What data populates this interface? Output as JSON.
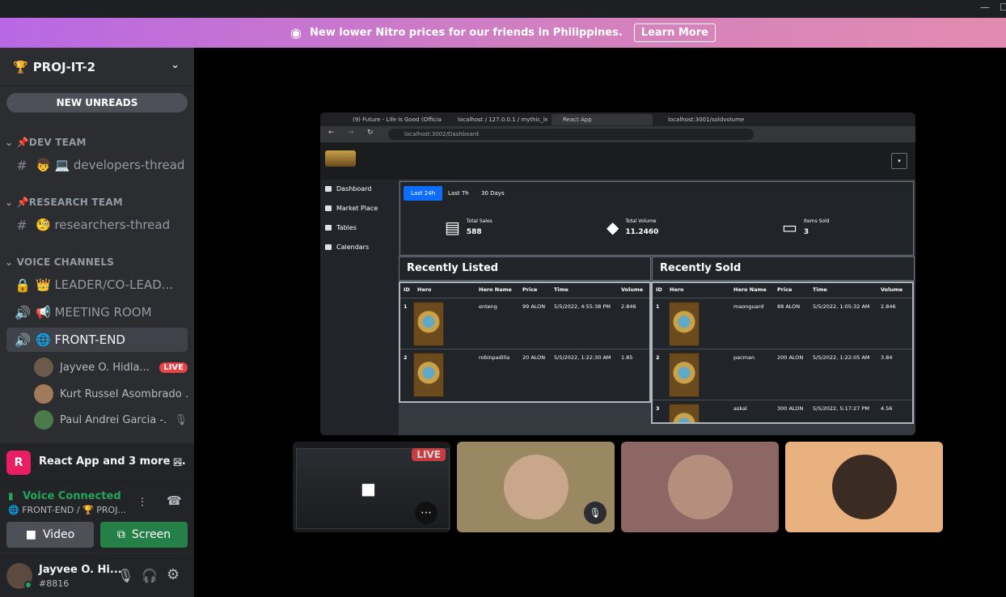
{
  "window": {
    "min": "—",
    "max": "☐"
  },
  "banner": {
    "text": "New lower Nitro prices for our friends in Philippines.",
    "button": "Learn More"
  },
  "server": {
    "name": "PROJ-IT-2",
    "new_unreads": "NEW UNREADS"
  },
  "categories": {
    "dev": "DEV TEAM",
    "research": "RESEARCH TEAM",
    "voice": "VOICE CHANNELS"
  },
  "channels": {
    "dev_thread": "👦 💻 developers-thread",
    "research_thread": "🧐 researchers-thread",
    "leader": "👑 LEADER/CO-LEAD...",
    "meeting": "📢 MEETING ROOM",
    "frontend": "🌐 FRONT-END"
  },
  "voice_users": [
    {
      "name": "Jayvee O. Hidla...",
      "badge": "LIVE"
    },
    {
      "name": "Kurt Russel Asombrado ..."
    },
    {
      "name": "Paul Andrei Garcia -..."
    }
  ],
  "activity": {
    "title": "React App and 3 more ..."
  },
  "voice": {
    "status": "Voice Connected",
    "channel": "🌐 FRONT-END / 🏆 PROJ..."
  },
  "buttons": {
    "video": "Video",
    "screen": "Screen"
  },
  "user": {
    "name": "Jayvee O. Hi...",
    "tag": "#8816"
  },
  "browser": {
    "tabs": [
      "(9) Future - Life Is Good (Officia",
      "localhost / 127.0.0.1 / mythic_le",
      "React App",
      "localhost:3001/soldvolume"
    ],
    "url": "localhost:3002/Dashboard",
    "nav": [
      "Dashboard",
      "Market Place",
      "Tables",
      "Calendars"
    ],
    "time_tabs": [
      "Last 24h",
      "Last 7h",
      "30 Days"
    ],
    "stats": [
      {
        "label": "Total Sales",
        "value": "588"
      },
      {
        "label": "Total Volume",
        "value": "11.2460"
      },
      {
        "label": "Items Sold",
        "value": "3"
      }
    ],
    "listed": {
      "title": "Recently Listed",
      "headers": [
        "ID",
        "Hero",
        "Hero Name",
        "Price",
        "Time",
        "Volume"
      ],
      "rows": [
        {
          "id": "1",
          "name": "enteng",
          "price": "99 ALON",
          "time": "5/5/2022, 4:55:38 PM",
          "volume": "2.846"
        },
        {
          "id": "2",
          "name": "robinpadilla",
          "price": "20 ALON",
          "time": "5/5/2022, 1:22:30 AM",
          "volume": "1.85"
        }
      ]
    },
    "sold": {
      "title": "Recently Sold",
      "headers": [
        "ID",
        "Hero",
        "Hero Name",
        "Price",
        "Time",
        "Volume"
      ],
      "rows": [
        {
          "id": "1",
          "name": "maonguard",
          "price": "88 ALON",
          "time": "5/5/2022, 1:05:32 AM",
          "volume": "2.846"
        },
        {
          "id": "2",
          "name": "pacman",
          "price": "200 ALON",
          "time": "5/5/2022, 1:22:05 AM",
          "volume": "3.84"
        },
        {
          "id": "3",
          "name": "askal",
          "price": "300 ALON",
          "time": "5/5/2022, 5:17:27 PM",
          "volume": "4.56"
        }
      ]
    }
  },
  "stream_badge": "LIVE",
  "colors": {
    "accent": "#5865f2",
    "green": "#248046",
    "live": "#ed4245"
  }
}
